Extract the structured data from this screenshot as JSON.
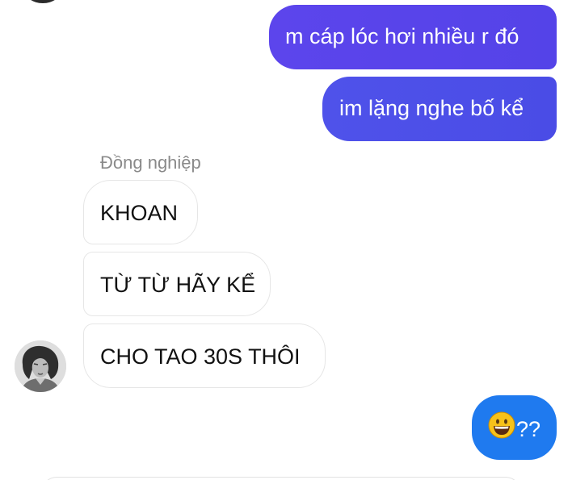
{
  "messages": [
    {
      "direction": "outgoing",
      "text": "m cáp lóc hơi nhiều r đó"
    },
    {
      "direction": "outgoing",
      "text": "im lặng nghe bố kể"
    },
    {
      "direction": "incoming",
      "text": "KHOAN"
    },
    {
      "direction": "incoming",
      "text": "TỪ TỪ HÃY KỂ"
    },
    {
      "direction": "incoming",
      "text": "CHO TAO 30S THÔI"
    },
    {
      "direction": "outgoing",
      "emoji": "grinning-face-icon",
      "text": "??"
    }
  ],
  "incoming_sender": {
    "name": "Đồng nghiệp",
    "avatar": "grayscale-profile-photo"
  },
  "colors": {
    "outgoing_top": "#5c45ec",
    "outgoing_mid": "#4f52ea",
    "outgoing_bottom": "#1f7aef",
    "incoming_border": "#e6e6e6",
    "sender_name": "#8a8a8a"
  }
}
